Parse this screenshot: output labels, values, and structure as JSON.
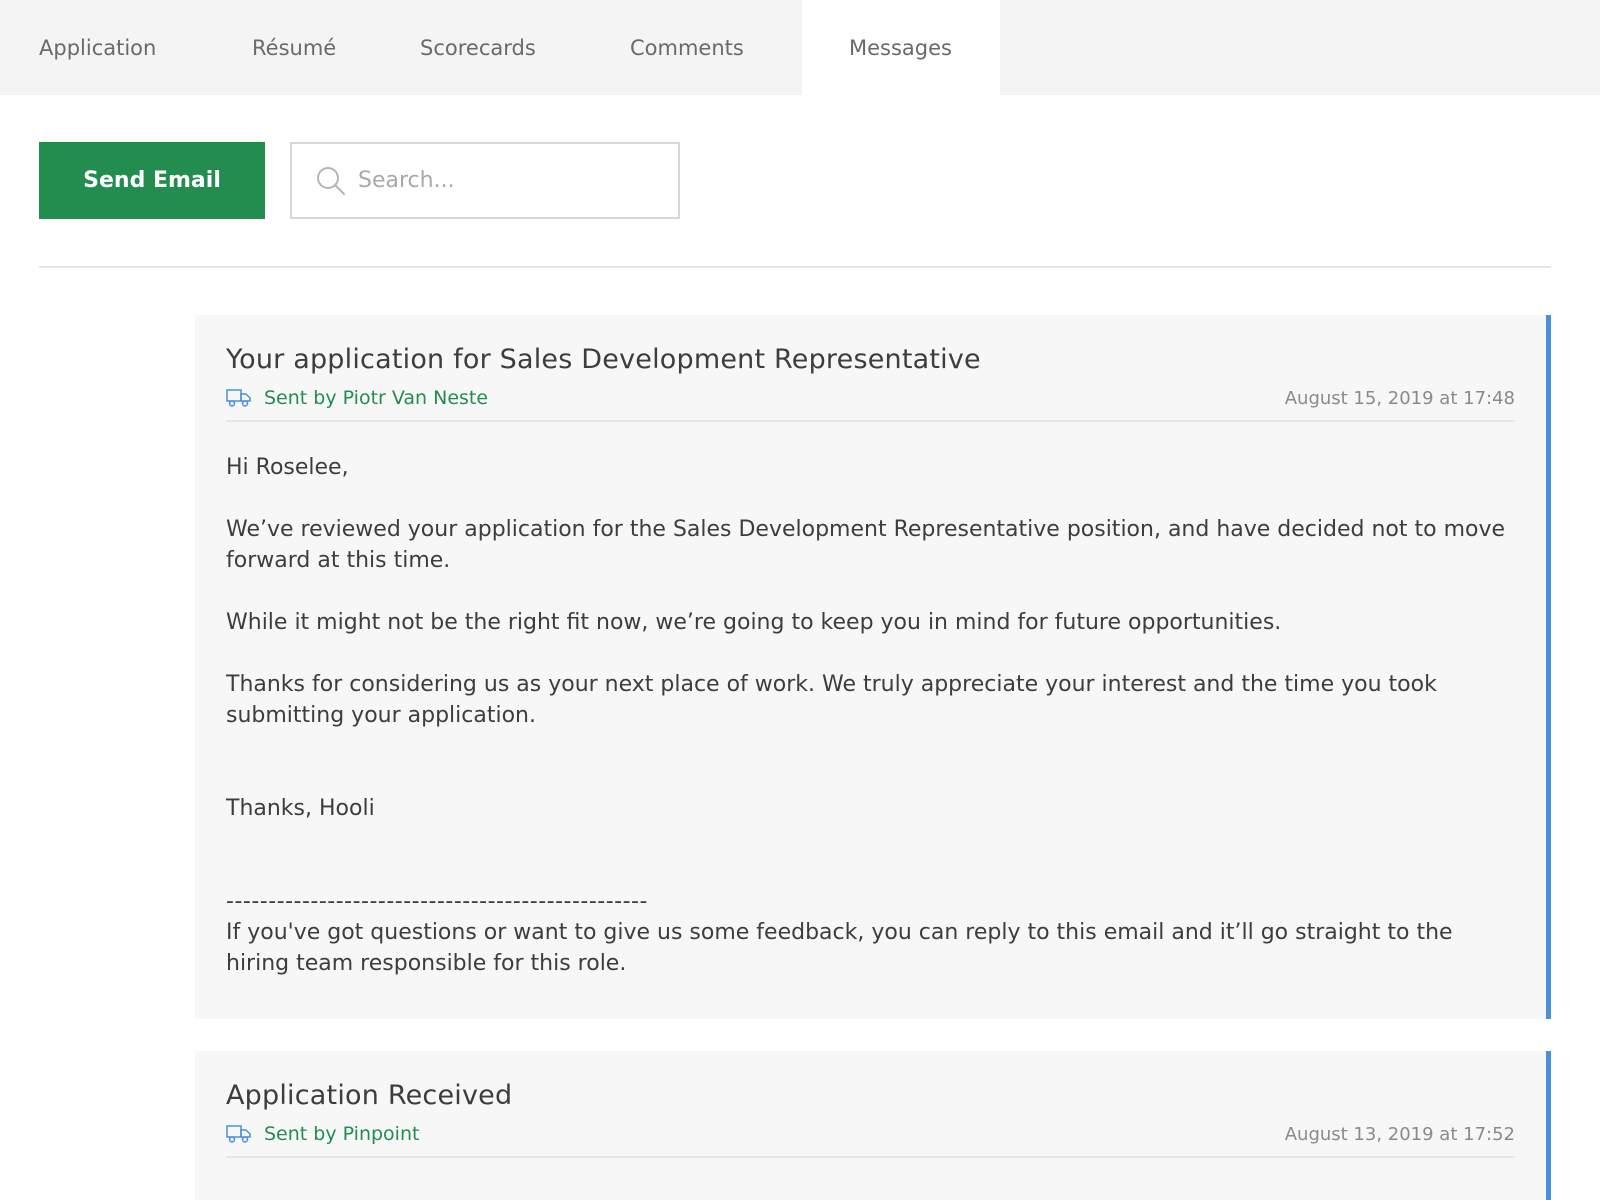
{
  "tabs": [
    {
      "label": "Application",
      "active": false
    },
    {
      "label": "Résumé",
      "active": false
    },
    {
      "label": "Scorecards",
      "active": false
    },
    {
      "label": "Comments",
      "active": false
    },
    {
      "label": "Messages",
      "active": true
    }
  ],
  "toolbar": {
    "send_email_label": "Send Email",
    "search_placeholder": "Search...",
    "search_value": "",
    "search_icon": "search-icon"
  },
  "colors": {
    "accent_green": "#238c4f",
    "card_border_blue": "#4a90d9"
  },
  "messages": [
    {
      "title": "Your application for Sales Development Representative",
      "sender_icon": "truck-icon",
      "sender": "Sent by Piotr Van Neste",
      "timestamp": "August 15, 2019 at 17:48",
      "body": {
        "greeting": "Hi Roselee,",
        "p1": "We’ve reviewed your application for the Sales Development Representative position, and have decided not to move forward at this time.",
        "p2": "While it might not be the right fit now, we’re going to keep you in mind for future opportunities.",
        "p3": "Thanks for considering us as your next place of work. We truly appreciate your interest and the time you took submitting your application.",
        "signoff": "Thanks, Hooli",
        "separator": "--------------------------------------------------",
        "footer": "If you've got questions or want to give us some feedback, you can reply to this email and it’ll go straight to the hiring team responsible for this role."
      }
    },
    {
      "title": "Application Received",
      "sender_icon": "truck-icon",
      "sender": "Sent by Pinpoint",
      "timestamp": "August 13, 2019 at 17:52"
    }
  ]
}
